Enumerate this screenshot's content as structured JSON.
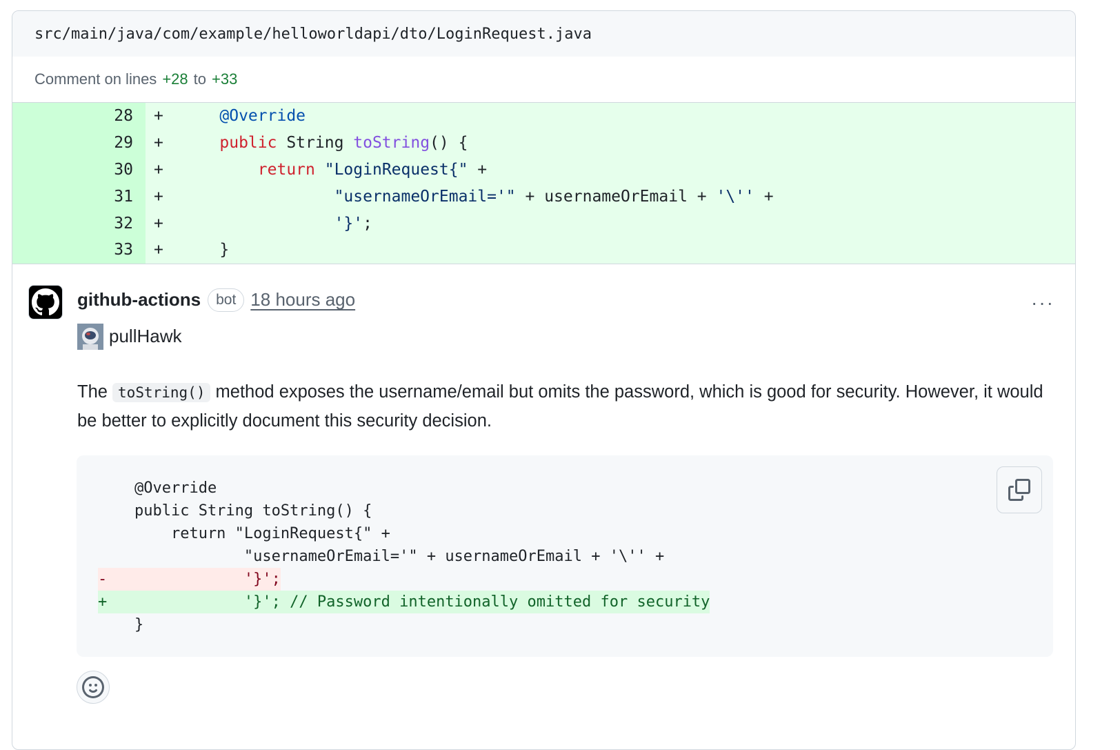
{
  "file": {
    "path": "src/main/java/com/example/helloworldapi/dto/LoginRequest.java"
  },
  "comment_range": {
    "prefix": "Comment on lines",
    "start": "+28",
    "mid": "to",
    "end": "+33"
  },
  "diff_lines": [
    {
      "num": "28",
      "sign": "+"
    },
    {
      "num": "29",
      "sign": "+"
    },
    {
      "num": "30",
      "sign": "+"
    },
    {
      "num": "31",
      "sign": "+"
    },
    {
      "num": "32",
      "sign": "+"
    },
    {
      "num": "33",
      "sign": "+"
    }
  ],
  "diff_code": {
    "l28": "@Override",
    "l29_kw": "public",
    "l29_type": " String ",
    "l29_fn": "toString",
    "l29_rest": "() {",
    "l30_kw": "return",
    "l30_str": "\"LoginRequest{\"",
    "l30_rest": " +",
    "l31_str": "\"usernameOrEmail='\"",
    "l31_mid": " + usernameOrEmail + ",
    "l31_str2": "'\\''",
    "l31_rest": " +",
    "l32_str": "'}'",
    "l32_rest": ";",
    "l33": "}"
  },
  "comment": {
    "author": "github-actions",
    "badge": "bot",
    "time": "18 hours ago",
    "more_label": "···",
    "sub_author": "pullHawk",
    "body_pre": "The ",
    "body_code": "toString()",
    "body_post": " method exposes the username/email but omits the password, which is good for security. However, it would be better to explicitly document this security decision."
  },
  "suggestion": {
    "lines": [
      "    @Override",
      "    public String toString() {",
      "        return \"LoginRequest{\" +",
      "                \"usernameOrEmail='\" + usernameOrEmail + '\\'' +",
      "-               '}';",
      "+               '}'; // Password intentionally omitted for security",
      "    }"
    ]
  },
  "colors": {
    "added_bg": "#e6ffec",
    "added_num_bg": "#ccffd8",
    "removed_bg": "#ffebe9",
    "border": "#d0d7de"
  }
}
